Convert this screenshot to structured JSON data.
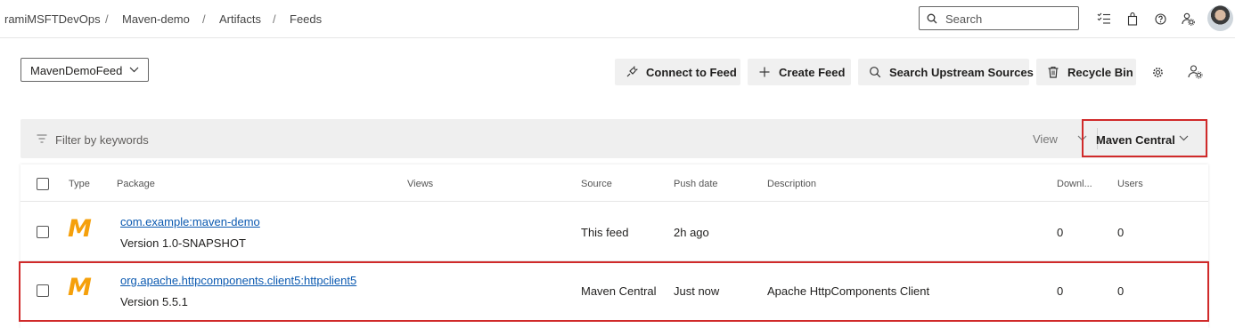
{
  "breadcrumb": {
    "items": [
      "ramiMSFTDevOps",
      "Maven-demo",
      "Artifacts",
      "Feeds"
    ],
    "separator": "/"
  },
  "header": {
    "search_placeholder": "Search",
    "icons": [
      "list-check-icon",
      "shopping-bag-icon",
      "help-icon",
      "user-settings-icon"
    ]
  },
  "feed": {
    "selected": "MavenDemoFeed"
  },
  "actions": {
    "connect_label": "Connect to Feed",
    "create_label": "Create Feed",
    "search_upstream_label": "Search Upstream Sources",
    "recycle_label": "Recycle Bin"
  },
  "filter": {
    "placeholder": "Filter by keywords",
    "view_label": "View",
    "source_selected": "Maven Central"
  },
  "table": {
    "columns": [
      "Type",
      "Package",
      "Views",
      "Source",
      "Push date",
      "Description",
      "Downl...",
      "Users"
    ],
    "rows": [
      {
        "type_icon": "M",
        "package": "com.example:maven-demo",
        "version": "Version 1.0-SNAPSHOT",
        "views": "",
        "source": "This feed",
        "push_date": "2h ago",
        "description": "",
        "downloads": "0",
        "users": "0"
      },
      {
        "type_icon": "M",
        "package": "org.apache.httpcomponents.client5:httpclient5",
        "version": "Version 5.5.1",
        "views": "",
        "source": "Maven Central",
        "push_date": "Just now",
        "description": "Apache HttpComponents Client",
        "downloads": "0",
        "users": "0"
      }
    ]
  },
  "colors": {
    "link": "#0b59b0",
    "maven_orange": "#f5a00b",
    "highlight_red": "#d02a2a",
    "button_bg": "#f0f0f0"
  }
}
